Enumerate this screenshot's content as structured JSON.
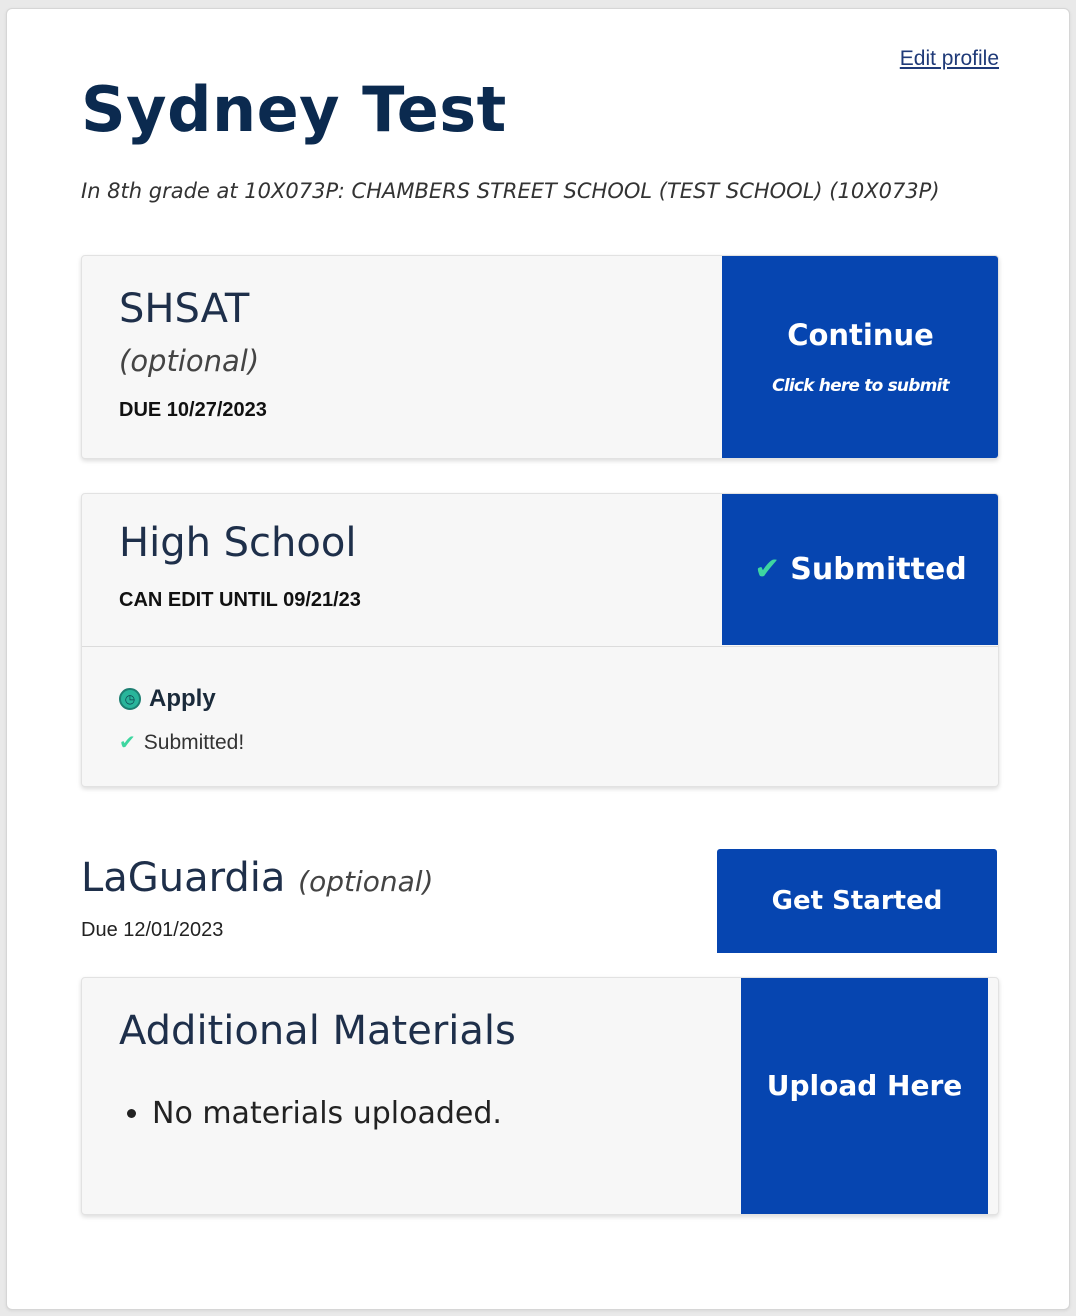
{
  "header": {
    "edit_profile": "Edit profile",
    "student_name": "Sydney Test",
    "grade_line": "In 8th grade at 10X073P: CHAMBERS STREET SCHOOL (TEST SCHOOL) (10X073P)"
  },
  "shsat": {
    "title": "SHSAT",
    "optional": "(optional)",
    "due": "DUE 10/27/2023",
    "action_label": "Continue",
    "action_sub": "Click here to submit"
  },
  "high_school": {
    "title": "High School",
    "edit_until": "CAN EDIT UNTIL 09/21/23",
    "status_label": "Submitted",
    "step_label": "Apply",
    "step_status": "Submitted!"
  },
  "laguardia": {
    "title": "LaGuardia",
    "optional": "(optional)",
    "due": "Due 12/01/2023",
    "action_label": "Get Started"
  },
  "additional_materials": {
    "title": "Additional Materials",
    "items": [
      "No materials uploaded."
    ],
    "action_label": "Upload Here"
  },
  "icons": {
    "check": "check-icon",
    "apply": "clock-circle-icon"
  },
  "colors": {
    "primary_blue": "#0645b0",
    "heading_navy": "#0b2a4f",
    "check_green": "#3ed6a0",
    "card_bg": "#f7f7f7"
  }
}
